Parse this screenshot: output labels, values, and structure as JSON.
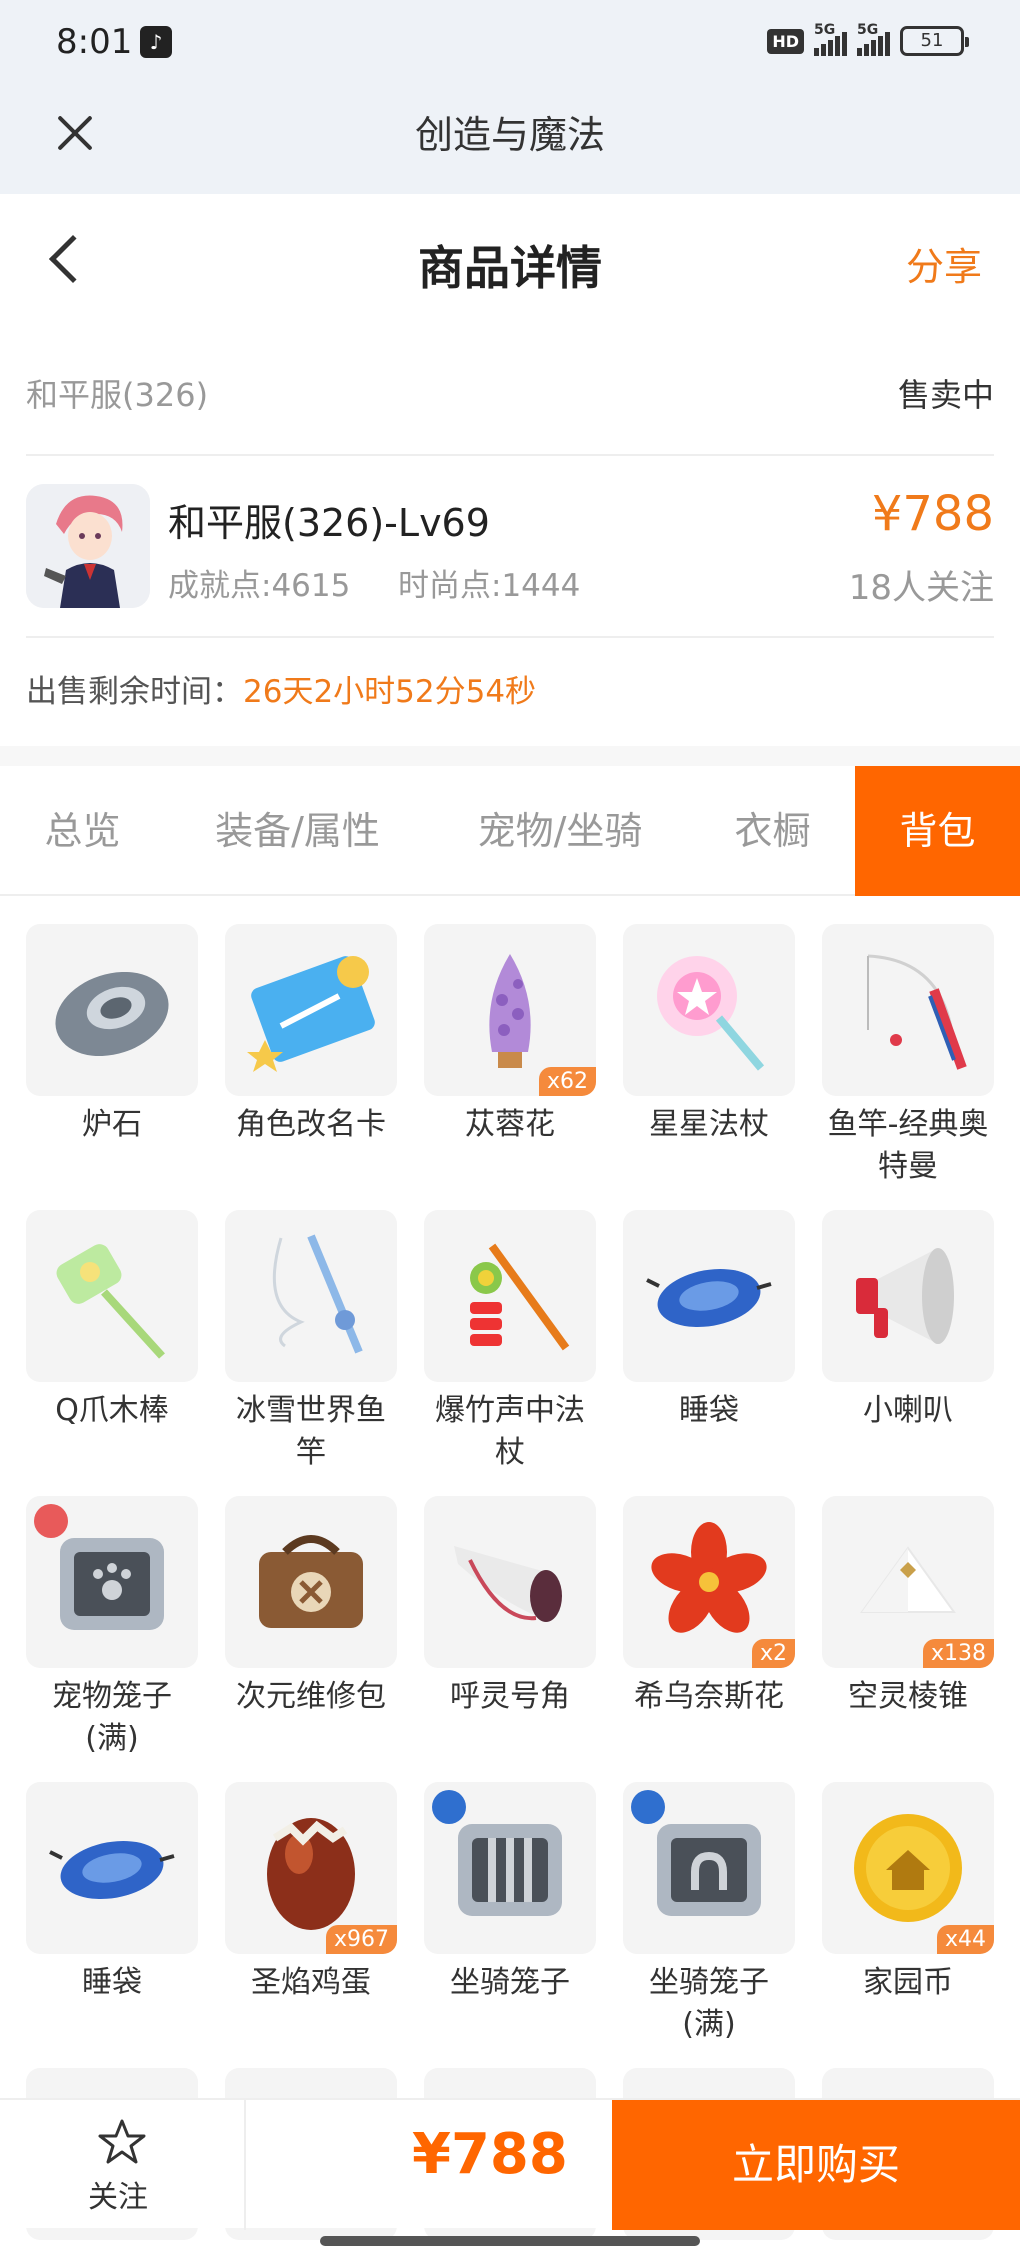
{
  "status_bar": {
    "time": "8:01",
    "hd": "HD",
    "net1": "5G",
    "net2": "5G",
    "battery": "51"
  },
  "app_bar": {
    "title": "创造与魔法"
  },
  "header": {
    "title": "商品详情",
    "share": "分享"
  },
  "listing": {
    "server": "和平服(326)",
    "status": "售卖中"
  },
  "role": {
    "name": "和平服(326)-Lv69",
    "achievement": "成就点:4615",
    "fashion": "时尚点:1444",
    "price": "¥788",
    "followers": "18人关注"
  },
  "remaining": {
    "label": "出售剩余时间：",
    "value": "26天2小时52分54秒"
  },
  "tabs": [
    {
      "label": "总览"
    },
    {
      "label": "装备/属性"
    },
    {
      "label": "宠物/坐骑"
    },
    {
      "label": "衣橱"
    },
    {
      "label": "背包"
    }
  ],
  "items": [
    {
      "name": "炉石",
      "qty": "",
      "icon": "hearthstone-icon"
    },
    {
      "name": "角色改名卡",
      "qty": "",
      "icon": "rename-card-icon"
    },
    {
      "name": "苁蓉花",
      "qty": "x62",
      "icon": "cistanche-flower-icon"
    },
    {
      "name": "星星法杖",
      "qty": "",
      "icon": "star-wand-icon"
    },
    {
      "name": "鱼竿-经典奥特曼",
      "qty": "",
      "icon": "fishing-rod-icon"
    },
    {
      "name": "Q爪木棒",
      "qty": "",
      "icon": "claw-stick-icon"
    },
    {
      "name": "冰雪世界鱼竿",
      "qty": "",
      "icon": "ice-fishing-rod-icon"
    },
    {
      "name": "爆竹声中法杖",
      "qty": "",
      "icon": "firecracker-staff-icon"
    },
    {
      "name": "睡袋",
      "qty": "",
      "icon": "sleeping-bag-icon"
    },
    {
      "name": "小喇叭",
      "qty": "",
      "icon": "megaphone-icon"
    },
    {
      "name": "宠物笼子(满)",
      "qty": "",
      "icon": "pet-cage-icon"
    },
    {
      "name": "次元维修包",
      "qty": "",
      "icon": "repair-bag-icon"
    },
    {
      "name": "呼灵号角",
      "qty": "",
      "icon": "horn-icon"
    },
    {
      "name": "希乌奈斯花",
      "qty": "x2",
      "icon": "red-flower-icon"
    },
    {
      "name": "空灵棱锥",
      "qty": "x138",
      "icon": "pyramid-icon"
    },
    {
      "name": "睡袋",
      "qty": "",
      "icon": "sleeping-bag-icon"
    },
    {
      "name": "圣焰鸡蛋",
      "qty": "x967",
      "icon": "egg-icon"
    },
    {
      "name": "坐骑笼子",
      "qty": "",
      "icon": "mount-cage-icon"
    },
    {
      "name": "坐骑笼子(满)",
      "qty": "",
      "icon": "mount-cage-full-icon"
    },
    {
      "name": "家园币",
      "qty": "x44",
      "icon": "home-coin-icon"
    }
  ],
  "bottom": {
    "follow": "关注",
    "price": "¥788",
    "buy": "立即购买"
  },
  "colors": {
    "accent": "#ff6600",
    "price": "#f07a1a",
    "badge": "#f58a3c"
  }
}
